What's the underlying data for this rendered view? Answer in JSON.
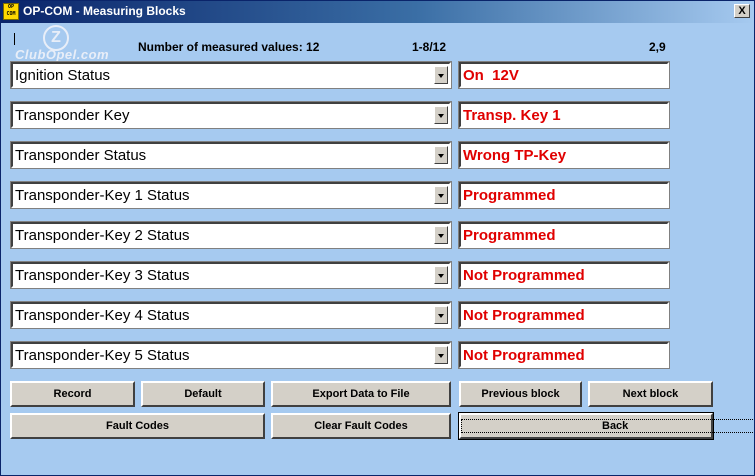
{
  "window": {
    "title": "OP-COM - Measuring Blocks",
    "icon_text": "OP COM",
    "close_label": "X"
  },
  "watermark": {
    "logo_glyph": "Z",
    "text": "ClubOpel.com"
  },
  "header": {
    "count_label": "Number of measured values: 12",
    "block_range": "1-8/12",
    "version": "2,9"
  },
  "rows": [
    {
      "label": "Ignition Status",
      "value": "On  12V"
    },
    {
      "label": "Transponder Key",
      "value": "Transp. Key 1"
    },
    {
      "label": "Transponder Status",
      "value": "Wrong TP-Key"
    },
    {
      "label": "Transponder-Key 1 Status",
      "value": "Programmed"
    },
    {
      "label": "Transponder-Key 2 Status",
      "value": "Programmed"
    },
    {
      "label": "Transponder-Key 3 Status",
      "value": "Not Programmed"
    },
    {
      "label": "Transponder-Key 4 Status",
      "value": "Not Programmed"
    },
    {
      "label": "Transponder-Key 5 Status",
      "value": "Not Programmed"
    }
  ],
  "buttons": {
    "record": "Record",
    "default": "Default",
    "export": "Export Data to File",
    "previous_block": "Previous block",
    "next_block": "Next block",
    "fault_codes": "Fault Codes",
    "clear_fault_codes": "Clear Fault Codes",
    "back": "Back"
  },
  "colors": {
    "background": "#a6caf0",
    "value_text": "#e00000",
    "button_face": "#d4d0c8"
  }
}
